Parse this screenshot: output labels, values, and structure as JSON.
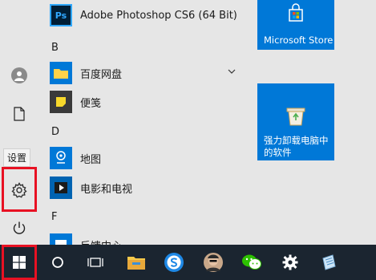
{
  "left_rail": {
    "settings_tooltip": "设置",
    "icons": [
      "user-icon",
      "document-icon",
      "settings-gear-icon",
      "power-icon"
    ]
  },
  "app_list": {
    "sections": [
      {
        "letter": "B"
      },
      {
        "letter": "D"
      },
      {
        "letter": "F"
      }
    ],
    "apps": [
      {
        "name": "Adobe Photoshop CS6 (64 Bit)",
        "icon": "photoshop-icon",
        "icon_text": "Ps"
      },
      {
        "name": "百度网盘",
        "icon": "folder-icon"
      },
      {
        "name": "便笺",
        "icon": "sticky-notes-icon"
      },
      {
        "name": "地图",
        "icon": "maps-icon"
      },
      {
        "name": "电影和电视",
        "icon": "movies-tv-icon"
      },
      {
        "name": "反馈中心",
        "icon": "feedback-hub-icon"
      }
    ]
  },
  "tiles": [
    {
      "label": "Microsoft Store",
      "icon": "store-bag-icon"
    },
    {
      "label_lines": [
        "强力卸载电脑中",
        "的软件"
      ],
      "icon": "recycle-bin-icon"
    }
  ],
  "taskbar": {
    "items": [
      "start-windows-icon",
      "cortana-search-icon",
      "task-view-icon",
      "file-explorer-icon",
      "sogou-browser-icon",
      "avatar-app-icon",
      "wechat-icon",
      "settings-icon",
      "notepad-icon"
    ]
  },
  "colors": {
    "tile_blue": "#0078d7",
    "taskbar": "#1b2530",
    "highlight_red": "#e81123",
    "start_menu_bg": "#e6e6e6"
  }
}
